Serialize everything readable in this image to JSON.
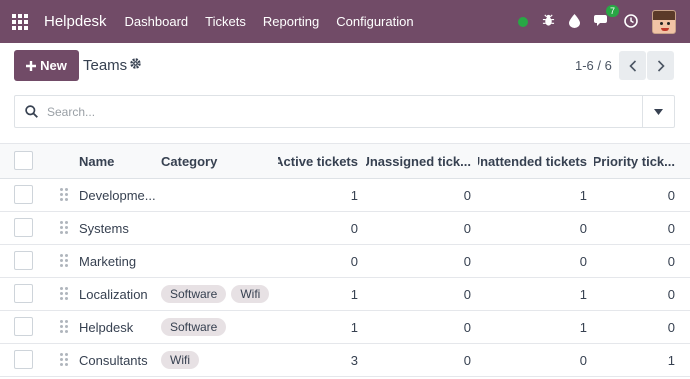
{
  "navbar": {
    "brand": "Helpdesk",
    "menu": [
      "Dashboard",
      "Tickets",
      "Reporting",
      "Configuration"
    ],
    "messages_badge": "7"
  },
  "control_panel": {
    "new_label": "New",
    "title": "Teams",
    "pager": "1-6 / 6"
  },
  "search": {
    "placeholder": "Search..."
  },
  "table": {
    "columns": [
      "Name",
      "Category",
      "Active tickets",
      "Unassigned tick...",
      "Unattended tickets",
      "Priority tick..."
    ],
    "rows": [
      {
        "name": "Developme...",
        "tags": [],
        "active": "1",
        "unassigned": "0",
        "unattended": "1",
        "priority": "0"
      },
      {
        "name": "Systems",
        "tags": [],
        "active": "0",
        "unassigned": "0",
        "unattended": "0",
        "priority": "0"
      },
      {
        "name": "Marketing",
        "tags": [],
        "active": "0",
        "unassigned": "0",
        "unattended": "0",
        "priority": "0"
      },
      {
        "name": "Localization",
        "tags": [
          "Software",
          "Wifi"
        ],
        "active": "1",
        "unassigned": "0",
        "unattended": "1",
        "priority": "0"
      },
      {
        "name": "Helpdesk",
        "tags": [
          "Software"
        ],
        "active": "1",
        "unassigned": "0",
        "unattended": "1",
        "priority": "0"
      },
      {
        "name": "Consultants",
        "tags": [
          "Wifi"
        ],
        "active": "3",
        "unassigned": "0",
        "unattended": "0",
        "priority": "1"
      }
    ]
  },
  "colors": {
    "brand": "#714B67",
    "status_online": "#28a745",
    "tag_bg": "#e7e1e4"
  }
}
